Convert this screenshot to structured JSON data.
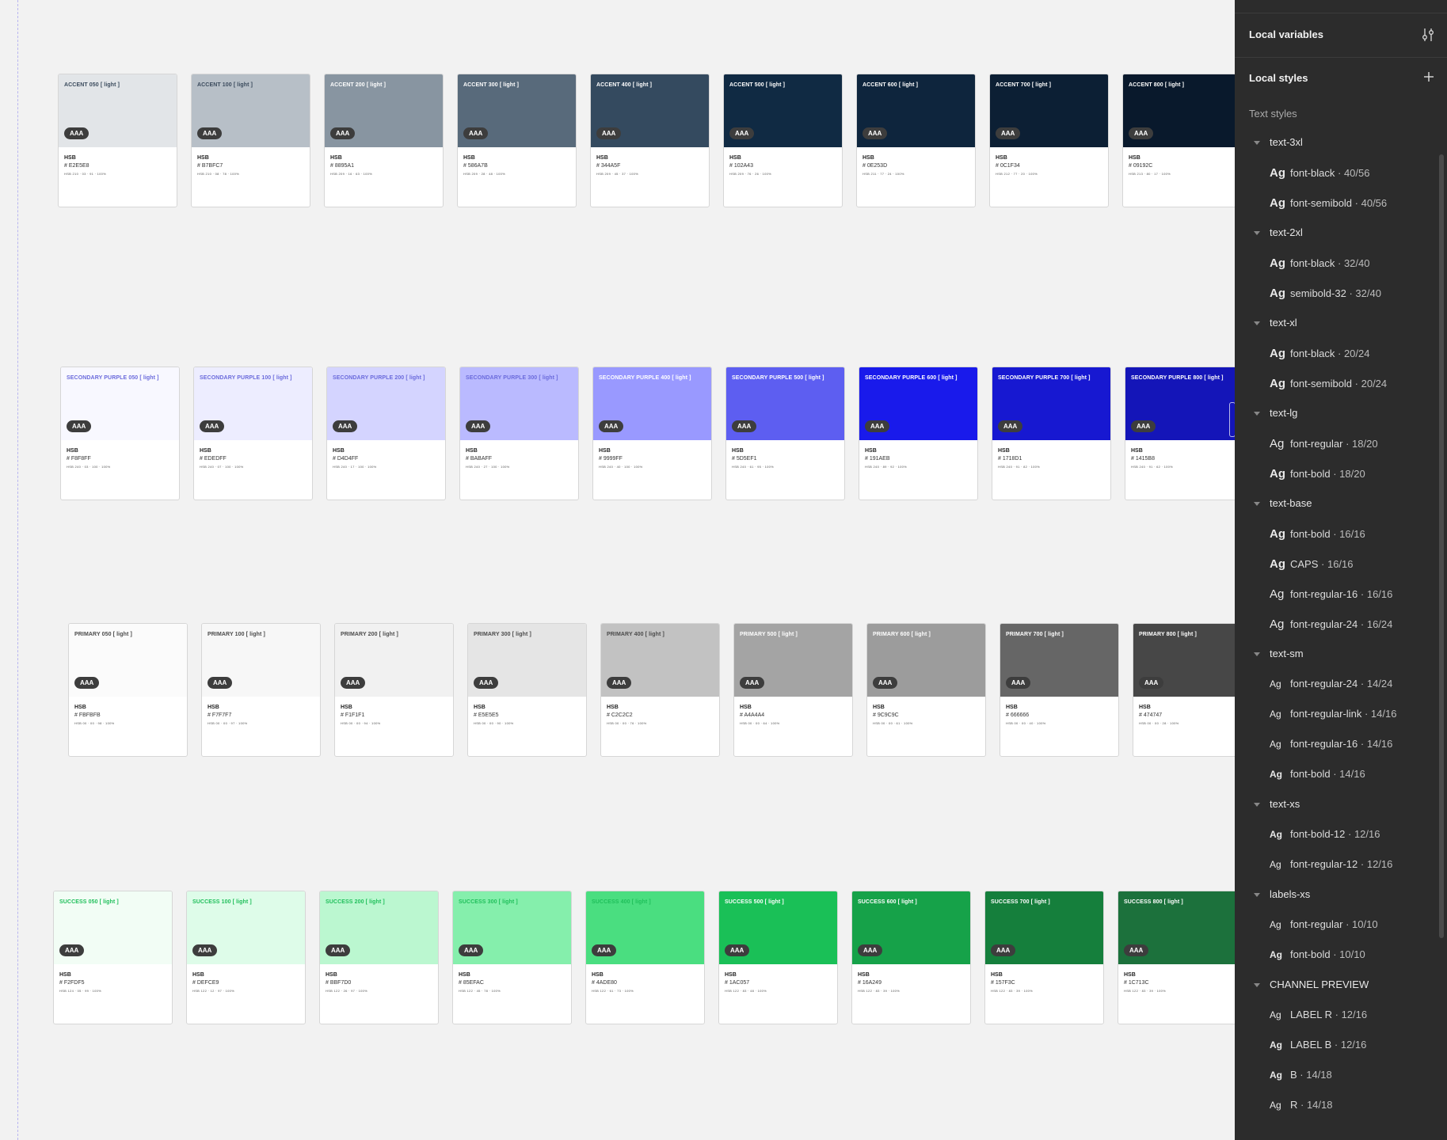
{
  "palette_rows": [
    {
      "name": "accent",
      "label_color": "#ffffff",
      "label_color_light": "#3a4a5c",
      "cards": [
        {
          "label": "ACCENT 050 [ light ]",
          "hex": "# E2E5E8",
          "hsb": "HSB 210 · 03 · 91 · 100%",
          "color": "#E2E5E8",
          "dark_label": true
        },
        {
          "label": "ACCENT 100 [ light ]",
          "hex": "# B7BFC7",
          "hsb": "HSB 210 · 08 · 78 · 100%",
          "color": "#B7BFC7",
          "dark_label": true
        },
        {
          "label": "ACCENT 200 [ light ]",
          "hex": "# 8895A1",
          "hsb": "HSB 209 · 16 · 63 · 100%",
          "color": "#8895A1",
          "dark_label": false
        },
        {
          "label": "ACCENT 300 [ light ]",
          "hex": "# 586A7B",
          "hsb": "HSB 209 · 28 · 48 · 100%",
          "color": "#586A7B",
          "dark_label": false
        },
        {
          "label": "ACCENT 400 [ light ]",
          "hex": "# 344A5F",
          "hsb": "HSB 209 · 45 · 37 · 100%",
          "color": "#344A5F",
          "dark_label": false
        },
        {
          "label": "ACCENT 500 [ light ]",
          "hex": "# 102A43",
          "hsb": "HSB 209 · 76 · 26 · 100%",
          "color": "#102A43",
          "dark_label": false
        },
        {
          "label": "ACCENT 600 [ light ]",
          "hex": "# 0E253D",
          "hsb": "HSB 211 · 77 · 24 · 100%",
          "color": "#0E253D",
          "dark_label": false
        },
        {
          "label": "ACCENT 700 [ light ]",
          "hex": "# 0C1F34",
          "hsb": "HSB 212 · 77 · 20 · 100%",
          "color": "#0C1F34",
          "dark_label": false
        },
        {
          "label": "ACCENT 800 [ light ]",
          "hex": "# 09192C",
          "hsb": "HSB 213 · 80 · 17 · 100%",
          "color": "#09192C",
          "dark_label": false
        }
      ]
    },
    {
      "name": "secondary-purple",
      "label_color": "#ffffff",
      "label_color_light": "#6b6bdc",
      "cards": [
        {
          "label": "SECONDARY PURPLE 050 [ light ]",
          "hex": "# F8F8FF",
          "hsb": "HSB 240 · 03 · 100 · 100%",
          "color": "#F8F8FF",
          "dark_label": true
        },
        {
          "label": "SECONDARY PURPLE 100 [ light ]",
          "hex": "# EDEDFF",
          "hsb": "HSB 240 · 07 · 100 · 100%",
          "color": "#EDEDFF",
          "dark_label": true
        },
        {
          "label": "SECONDARY PURPLE 200 [ light ]",
          "hex": "# D4D4FF",
          "hsb": "HSB 240 · 17 · 100 · 100%",
          "color": "#D4D4FF",
          "dark_label": true
        },
        {
          "label": "SECONDARY PURPLE 300 [ light ]",
          "hex": "# BABAFF",
          "hsb": "HSB 240 · 27 · 100 · 100%",
          "color": "#BABAFF",
          "dark_label": true
        },
        {
          "label": "SECONDARY PURPLE 400 [ light ]",
          "hex": "# 9999FF",
          "hsb": "HSB 240 · 40 · 100 · 100%",
          "color": "#9999FF",
          "dark_label": false
        },
        {
          "label": "SECONDARY PURPLE 500 [ light ]",
          "hex": "# 5D5EF1",
          "hsb": "HSB 240 · 61 · 95 · 100%",
          "color": "#5D5EF1",
          "dark_label": false
        },
        {
          "label": "SECONDARY PURPLE 600 [ light ]",
          "hex": "# 191AEB",
          "hsb": "HSB 240 · 89 · 92 · 100%",
          "color": "#191AEB",
          "dark_label": false
        },
        {
          "label": "SECONDARY PURPLE 700 [ light ]",
          "hex": "# 1718D1",
          "hsb": "HSB 240 · 91 · 82 · 100%",
          "color": "#1718D1",
          "dark_label": false
        },
        {
          "label": "SECONDARY PURPLE 800 [ light ]",
          "hex": "# 1415B8",
          "hsb": "HSB 240 · 91 · 62 · 100%",
          "color": "#1415B8",
          "dark_label": false
        }
      ]
    },
    {
      "name": "primary",
      "label_color": "#ffffff",
      "label_color_light": "#4a4a4a",
      "cards": [
        {
          "label": "PRIMARY 050 [ light ]",
          "hex": "# FBFBFB",
          "hsb": "HSB 00 · 00 · 98 · 100%",
          "color": "#FBFBFB",
          "dark_label": true
        },
        {
          "label": "PRIMARY 100 [ light ]",
          "hex": "# F7F7F7",
          "hsb": "HSB 00 · 00 · 97 · 100%",
          "color": "#F7F7F7",
          "dark_label": true
        },
        {
          "label": "PRIMARY 200 [ light ]",
          "hex": "# F1F1F1",
          "hsb": "HSB 00 · 00 · 94 · 100%",
          "color": "#F1F1F1",
          "dark_label": true
        },
        {
          "label": "PRIMARY 300 [ light ]",
          "hex": "# E5E5E5",
          "hsb": "HSB 00 · 00 · 90 · 100%",
          "color": "#E5E5E5",
          "dark_label": true
        },
        {
          "label": "PRIMARY 400 [ light ]",
          "hex": "# C2C2C2",
          "hsb": "HSB 00 · 00 · 76 · 100%",
          "color": "#C2C2C2",
          "dark_label": true
        },
        {
          "label": "PRIMARY 500 [ light ]",
          "hex": "# A4A4A4",
          "hsb": "HSB 00 · 00 · 64 · 100%",
          "color": "#A4A4A4",
          "dark_label": false
        },
        {
          "label": "PRIMARY 600 [ light ]",
          "hex": "# 9C9C9C",
          "hsb": "HSB 00 · 00 · 61 · 100%",
          "color": "#9C9C9C",
          "dark_label": false
        },
        {
          "label": "PRIMARY 700 [ light ]",
          "hex": "# 666666",
          "hsb": "HSB 00 · 00 · 40 · 100%",
          "color": "#666666",
          "dark_label": false
        },
        {
          "label": "PRIMARY 800 [ light ]",
          "hex": "# 474747",
          "hsb": "HSB 00 · 00 · 28 · 100%",
          "color": "#474747",
          "dark_label": false
        }
      ]
    },
    {
      "name": "success",
      "label_color": "#ffffff",
      "label_color_light": "#1fbf5a",
      "cards": [
        {
          "label": "SUCCESS 050 [ light ]",
          "hex": "# F2FDF5",
          "hsb": "HSB 124 · 05 · 99 · 100%",
          "color": "#F2FDF5",
          "dark_label": true
        },
        {
          "label": "SUCCESS 100 [ light ]",
          "hex": "# DEFCE9",
          "hsb": "HSB 122 · 12 · 97 · 100%",
          "color": "#DEFCE9",
          "dark_label": true
        },
        {
          "label": "SUCCESS 200 [ light ]",
          "hex": "# BBF7D0",
          "hsb": "HSB 122 · 26 · 97 · 100%",
          "color": "#BBF7D0",
          "dark_label": true
        },
        {
          "label": "SUCCESS 300 [ light ]",
          "hex": "# 85EFAC",
          "hsb": "HSB 122 · 45 · 78 · 100%",
          "color": "#85EFAC",
          "dark_label": true
        },
        {
          "label": "SUCCESS 400 [ light ]",
          "hex": "# 4ADE80",
          "hsb": "HSB 122 · 61 · 73 · 100%",
          "color": "#4ADE80",
          "dark_label": true
        },
        {
          "label": "SUCCESS 500 [ light ]",
          "hex": "# 1AC057",
          "hsb": "HSB 122 · 83 · 48 · 100%",
          "color": "#1AC057",
          "dark_label": false
        },
        {
          "label": "SUCCESS 600 [ light ]",
          "hex": "# 16A249",
          "hsb": "HSB 122 · 83 · 39 · 100%",
          "color": "#16A249",
          "dark_label": false
        },
        {
          "label": "SUCCESS 700 [ light ]",
          "hex": "# 157F3C",
          "hsb": "HSB 122 · 83 · 39 · 100%",
          "color": "#157F3C",
          "dark_label": false
        },
        {
          "label": "SUCCESS 800 [ light ]",
          "hex": "# 1C713C",
          "hsb": "HSB 122 · 83 · 39 · 100%",
          "color": "#1C713C",
          "dark_label": false
        }
      ]
    }
  ],
  "common": {
    "badge": "AAA",
    "hsb_title": "HSB"
  },
  "panel": {
    "local_variables": "Local variables",
    "local_styles": "Local styles",
    "text_styles": "Text styles",
    "variables_icon": "sliders-icon",
    "add_icon": "plus-icon",
    "groups": [
      {
        "name": "text-3xl",
        "items": [
          {
            "name": "font-black",
            "meta": "40/56",
            "weight": "bold"
          },
          {
            "name": "font-semibold",
            "meta": "40/56",
            "weight": "semibold"
          }
        ]
      },
      {
        "name": "text-2xl",
        "items": [
          {
            "name": "font-black",
            "meta": "32/40",
            "weight": "bold"
          },
          {
            "name": "semibold-32",
            "meta": "32/40",
            "weight": "semibold"
          }
        ]
      },
      {
        "name": "text-xl",
        "items": [
          {
            "name": "font-black",
            "meta": "20/24",
            "weight": "bold"
          },
          {
            "name": "font-semibold",
            "meta": "20/24",
            "weight": "semibold"
          }
        ]
      },
      {
        "name": "text-lg",
        "items": [
          {
            "name": "font-regular",
            "meta": "18/20",
            "weight": "regular"
          },
          {
            "name": "font-bold",
            "meta": "18/20",
            "weight": "bold"
          }
        ]
      },
      {
        "name": "text-base",
        "items": [
          {
            "name": "font-bold",
            "meta": "16/16",
            "weight": "bold"
          },
          {
            "name": "CAPS",
            "meta": "16/16",
            "weight": "bold"
          },
          {
            "name": "font-regular-16",
            "meta": "16/16",
            "weight": "regular"
          },
          {
            "name": "font-regular-24",
            "meta": "16/24",
            "weight": "regular"
          }
        ]
      },
      {
        "name": "text-sm",
        "items": [
          {
            "name": "font-regular-24",
            "meta": "14/24",
            "weight": "regular"
          },
          {
            "name": "font-regular-link",
            "meta": "14/16",
            "weight": "regular"
          },
          {
            "name": "font-regular-16",
            "meta": "14/16",
            "weight": "regular"
          },
          {
            "name": "font-bold",
            "meta": "14/16",
            "weight": "bold"
          }
        ]
      },
      {
        "name": "text-xs",
        "items": [
          {
            "name": "font-bold-12",
            "meta": "12/16",
            "weight": "bold"
          },
          {
            "name": "font-regular-12",
            "meta": "12/16",
            "weight": "regular"
          }
        ]
      },
      {
        "name": "labels-xs",
        "items": [
          {
            "name": "font-regular",
            "meta": "10/10",
            "weight": "regular"
          },
          {
            "name": "font-bold",
            "meta": "10/10",
            "weight": "bold"
          }
        ]
      },
      {
        "name": "CHANNEL PREVIEW",
        "items": [
          {
            "name": "LABEL R",
            "meta": "12/16",
            "weight": "regular"
          },
          {
            "name": "LABEL B",
            "meta": "12/16",
            "weight": "bold"
          },
          {
            "name": "B",
            "meta": "14/18",
            "weight": "bold"
          },
          {
            "name": "R",
            "meta": "14/18",
            "weight": "regular"
          }
        ]
      }
    ]
  }
}
